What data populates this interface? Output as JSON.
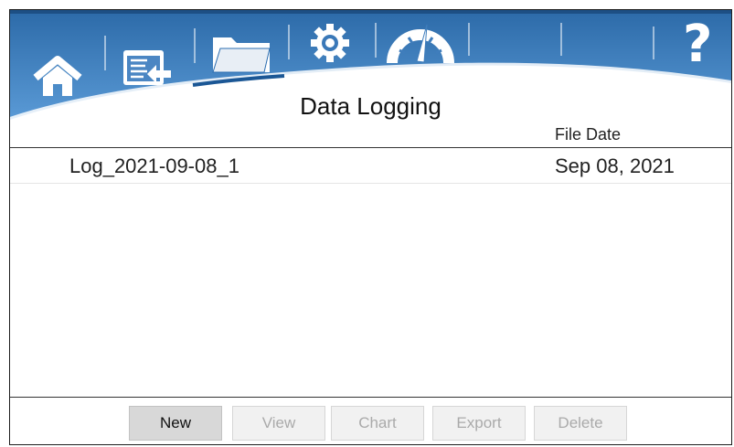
{
  "header": {
    "title": "Data Logging",
    "icons": [
      "home-icon",
      "import-log-icon",
      "folder-icon",
      "gear-icon",
      "gauge-icon",
      "help-icon"
    ],
    "help_glyph": "?"
  },
  "table": {
    "column_header_date": "File Date",
    "rows": [
      {
        "name": "Log_2021-09-08_1",
        "date": "Sep 08, 2021"
      }
    ]
  },
  "toolbar": {
    "new_label": "New",
    "view_label": "View",
    "chart_label": "Chart",
    "export_label": "Export",
    "delete_label": "Delete"
  },
  "colors": {
    "header_dark": "#1f5c97",
    "header_light": "#4d8ed0",
    "accent_curve": "#2a6cb0",
    "icon_white": "#ffffff"
  }
}
